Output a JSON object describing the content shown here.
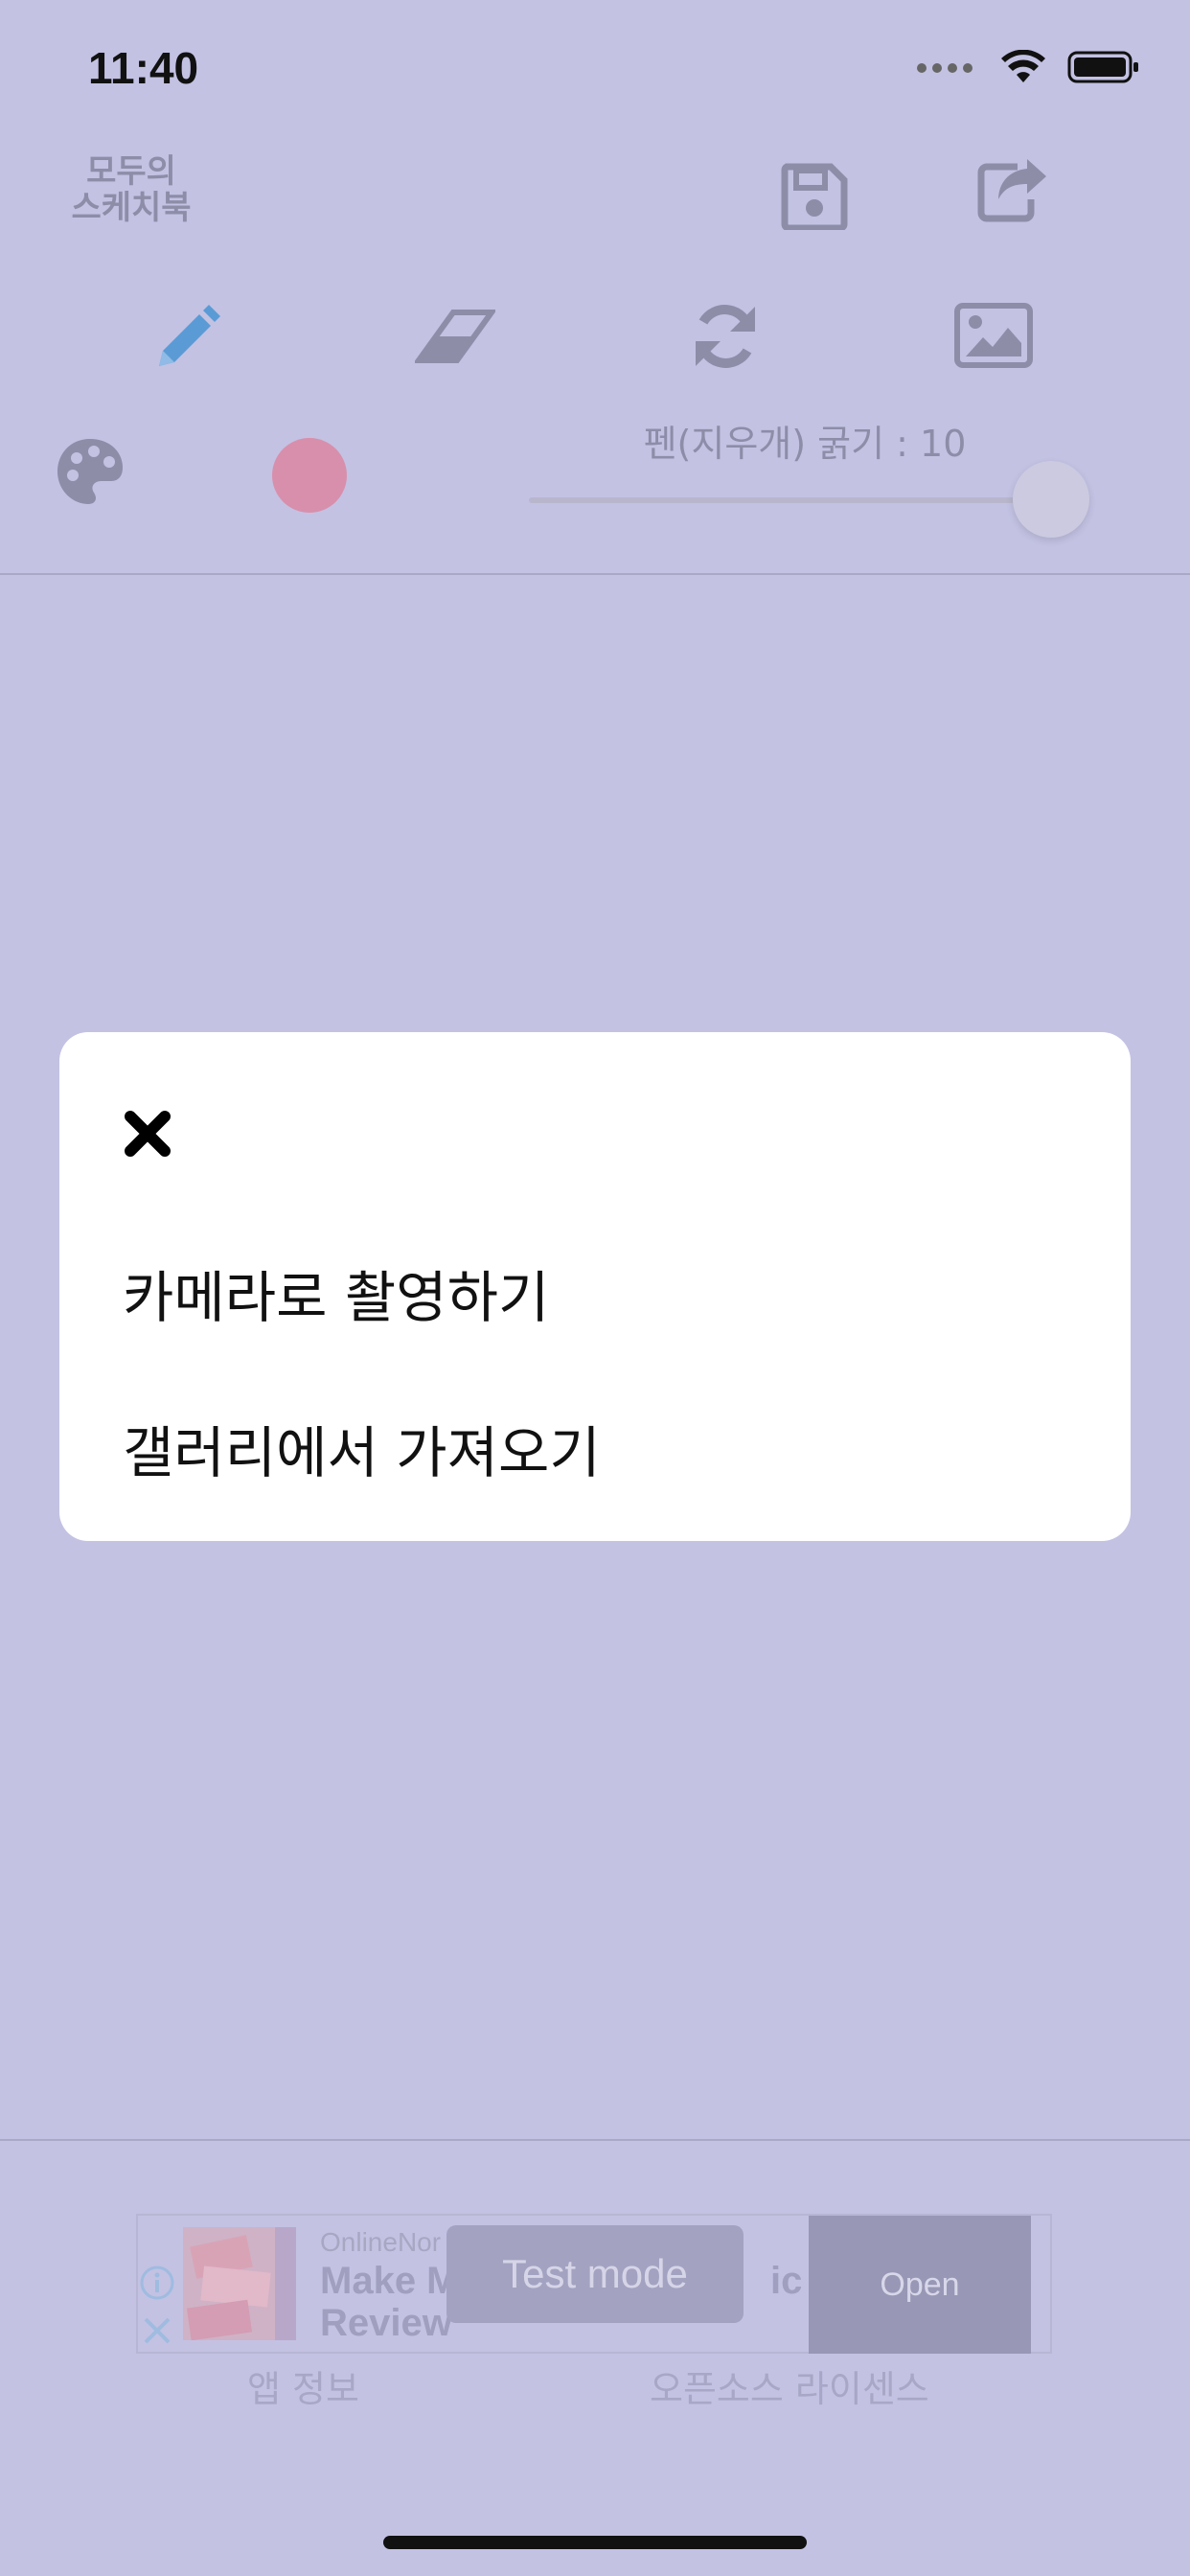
{
  "status_bar": {
    "time": "11:40"
  },
  "app": {
    "logo_line1": "모두의",
    "logo_line2": "스케치북"
  },
  "toolbar": {
    "save_icon": "floppy-disk-icon",
    "share_icon": "share-arrow-icon",
    "pencil_icon": "pencil-icon",
    "eraser_icon": "eraser-icon",
    "refresh_icon": "refresh-icon",
    "image_icon": "image-icon",
    "palette_icon": "palette-icon",
    "pen_width_label": "펜(지우개) 굵기 : 10",
    "pen_width_value": 10,
    "selected_color": "#d88fac",
    "accent_color": "#5b9bd5"
  },
  "ad": {
    "sponsor": "OnlineNor",
    "headline_part1": "Make M",
    "headline_part1_line2": "Review",
    "headline_part2": "ic",
    "open_label": "Open",
    "test_mode_label": "Test mode"
  },
  "footer": {
    "app_info": "앱 정보",
    "licenses": "오픈소스 라이센스"
  },
  "modal": {
    "close_icon": "close-icon",
    "option_camera": "카메라로 촬영하기",
    "option_gallery": "갤러리에서 가져오기"
  }
}
